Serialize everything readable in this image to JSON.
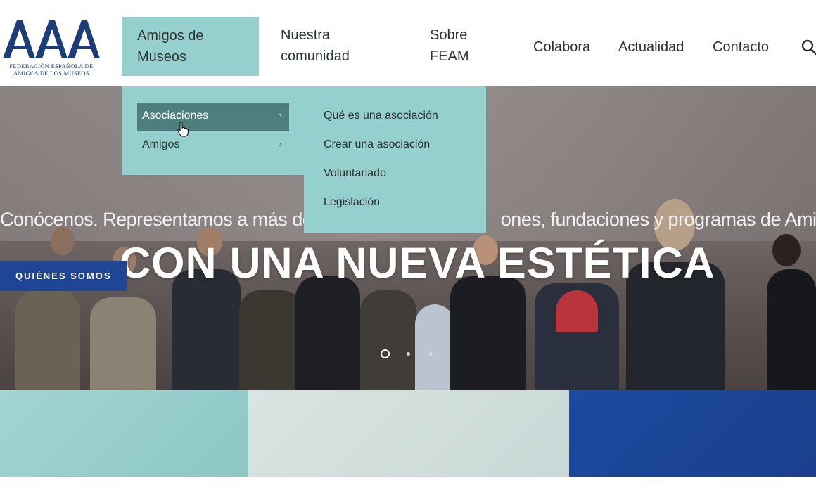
{
  "logo": {
    "mark": "AAA",
    "line1": "FEDERACIÓN ESPAÑOLA DE",
    "line2": "AMIGOS DE LOS MUSEOS"
  },
  "nav": {
    "amigos_line1": "Amigos de",
    "amigos_line2": "Museos",
    "comunidad_line1": "Nuestra",
    "comunidad_line2": "comunidad",
    "feam_line1": "Sobre",
    "feam_line2": "FEAM",
    "colabora": "Colabora",
    "actualidad": "Actualidad",
    "contacto": "Contacto"
  },
  "submenu": {
    "items": [
      {
        "label": "Asociaciones",
        "chevron": "›"
      },
      {
        "label": "Amigos",
        "chevron": "›"
      }
    ]
  },
  "flyout": {
    "items": [
      "Qué es una asociación",
      "Crear una asociación",
      "Voluntariado",
      "Legislación"
    ]
  },
  "hero": {
    "lead_part1": "Conócenos. Representamos a más de u",
    "lead_part2": "ones, fundaciones y programas de Amigos.",
    "title": "CON UNA NUEVA ESTÉTICA",
    "cta": "QUIÉNES SOMOS",
    "slides_total": 3,
    "slide_active": 1
  },
  "icons": {
    "search": "search-icon",
    "cursor": "hand-pointer-icon",
    "chevron": "chevron-right-icon"
  },
  "colors": {
    "menu_teal": "#96d0ce",
    "menu_active": "#4f7f7d",
    "brand_blue": "#1e4596",
    "logo_blue": "#1d3c7a"
  }
}
